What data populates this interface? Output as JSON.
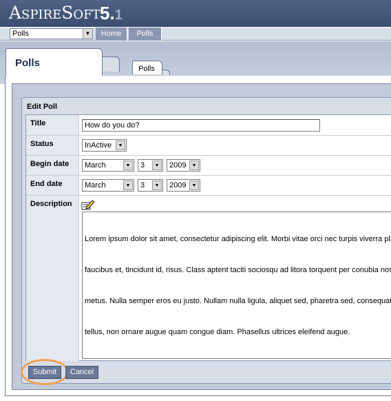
{
  "app": {
    "logo_brand": "AspireSoft",
    "logo_tm": "™",
    "version_major": "5.",
    "version_minor": "1"
  },
  "nav": {
    "module_select_value": "Polls",
    "links": [
      {
        "label": "Home"
      },
      {
        "label": "Polls"
      }
    ]
  },
  "tabs": {
    "main_tab": "Polls",
    "sub_tab": "Polls"
  },
  "form": {
    "heading": "Edit Poll",
    "title_label": "Title",
    "title_value": "How do you do?",
    "status_label": "Status",
    "status_value": "InActive",
    "begin_label": "Begin date",
    "begin_month": "March",
    "begin_day": "3",
    "begin_year": "2009",
    "end_label": "End date",
    "end_month": "March",
    "end_day": "3",
    "end_year": "2009",
    "description_label": "Description",
    "description_lines": [
      "Lorem ipsum dolor sit amet, consectetur adipiscing elit. Morbi vitae orci nec turpis viverra placerat",
      "faucibus et, tincidunt id, risus. Class aptent taciti sociosqu ad litora torquent per conubia nostra",
      "metus. Nulla semper eros eu justo. Nullam nulla ligula, aliquet sed, pharetra sed, consequat ornare",
      "tellus, non ornare augue quam congue diam. Phasellus ultrices eleifend augue."
    ],
    "submit_label": "Submit",
    "cancel_label": "Cancel"
  },
  "colors": {
    "header_bg": "#3b4e6f",
    "button_bg": "#6a7898",
    "highlight": "#f0a050"
  },
  "icons": {
    "select_arrow": "triangle-down-icon",
    "description_edit": "pencil-edit-icon"
  }
}
